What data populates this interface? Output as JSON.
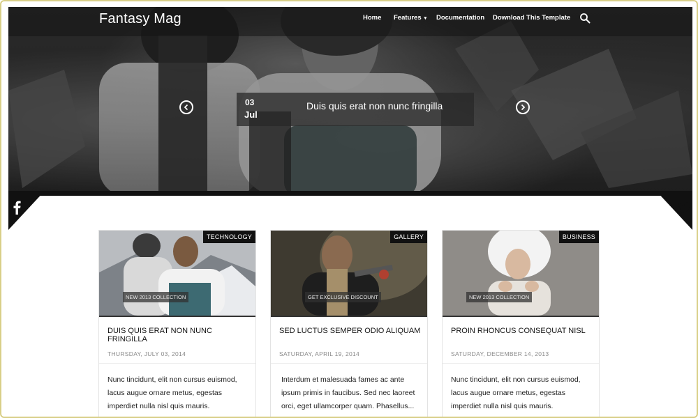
{
  "header": {
    "site_title": "Fantasy Mag",
    "nav": [
      {
        "label": "Home"
      },
      {
        "label": "Features",
        "caret": "▾"
      },
      {
        "label": "Documentation"
      },
      {
        "label": "Download This Template"
      }
    ]
  },
  "slider": {
    "caption": {
      "day": "03",
      "month": "Jul",
      "title": "Duis quis erat non nunc fringilla"
    }
  },
  "cards": [
    {
      "category": "TECHNOLOGY",
      "ribbon": "NEW 2013 COLLECTION",
      "title": "DUIS QUIS ERAT NON NUNC FRINGILLA",
      "date": "THURSDAY, JULY 03, 2014",
      "excerpt": "Nunc tincidunt, elit non cursus euismod, lacus augue ornare metus, egestas imperdiet nulla nisl quis mauris."
    },
    {
      "category": "GALLERY",
      "ribbon": "GET EXCLUSIVE DISCOUNT",
      "title": "SED LUCTUS SEMPER ODIO ALIQUAM",
      "date": "SATURDAY, APRIL 19, 2014",
      "excerpt": "Interdum et malesuada fames ac ante ipsum primis in faucibus. Sed nec laoreet orci, eget ullamcorper quam. Phasellus..."
    },
    {
      "category": "BUSINESS",
      "ribbon": "NEW 2013 COLLECTION",
      "title": "PROIN RHONCUS CONSEQUAT NISL",
      "date": "SATURDAY, DECEMBER 14, 2013",
      "excerpt": "Nunc tincidunt, elit non cursus euismod, lacus augue ornare metus, egestas imperdiet nulla nisl quis mauris."
    }
  ],
  "icons": {
    "search": "search-icon",
    "prev": "chevron-left-icon",
    "next": "chevron-right-icon",
    "facebook": "facebook-icon",
    "twitter": "twitter-icon"
  },
  "colors": {
    "frame_border": "#d9cf88",
    "dark": "#111111",
    "tag_bg": "#111111",
    "date_text": "#888888"
  }
}
